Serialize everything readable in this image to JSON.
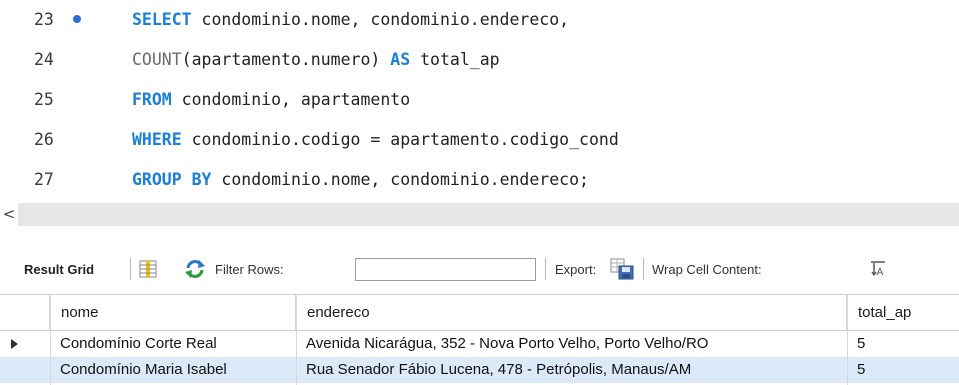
{
  "editor": {
    "lines": [
      {
        "number": "23",
        "breakpoint": true,
        "segments": [
          {
            "t": "SELECT",
            "k": "kw"
          },
          {
            "t": " condominio.nome, condominio.endereco,",
            "k": ""
          }
        ]
      },
      {
        "number": "24",
        "breakpoint": false,
        "segments": [
          {
            "t": "COUNT",
            "k": "fn"
          },
          {
            "t": "(apartamento.numero) ",
            "k": ""
          },
          {
            "t": "AS",
            "k": "kw"
          },
          {
            "t": " total_ap",
            "k": ""
          }
        ]
      },
      {
        "number": "25",
        "breakpoint": false,
        "segments": [
          {
            "t": "FROM",
            "k": "kw"
          },
          {
            "t": " condominio, apartamento",
            "k": ""
          }
        ]
      },
      {
        "number": "26",
        "breakpoint": false,
        "segments": [
          {
            "t": "WHERE",
            "k": "kw"
          },
          {
            "t": " condominio.codigo = apartamento.codigo_cond",
            "k": ""
          }
        ]
      },
      {
        "number": "27",
        "breakpoint": false,
        "segments": [
          {
            "t": "GROUP BY",
            "k": "kw"
          },
          {
            "t": " condominio.nome, condominio.endereco;",
            "k": ""
          }
        ]
      }
    ]
  },
  "scrollbar": {
    "left_arrow": "<"
  },
  "toolbar": {
    "result_grid_label": "Result Grid",
    "filter_rows_label": "Filter Rows:",
    "filter_rows_value": "",
    "export_label": "Export:",
    "wrap_label": "Wrap Cell Content:",
    "icons": [
      "grid-form-icon",
      "refresh-icon",
      "export-icon",
      "wrap-icon"
    ]
  },
  "grid": {
    "columns": [
      "nome",
      "endereco",
      "total_ap"
    ],
    "rows": [
      [
        "Condomínio Corte Real",
        "Avenida Nicarágua, 352 - Nova Porto Velho, Porto Velho/RO",
        "5"
      ],
      [
        "Condomínio Maria Isabel",
        "Rua Senador Fábio Lucena, 478 - Petrópolis, Manaus/AM",
        "5"
      ]
    ]
  },
  "colors": {
    "keyword": "#1a7fd8",
    "selected_row": "#dce9f8",
    "breakpoint": "#2b6fd6"
  }
}
